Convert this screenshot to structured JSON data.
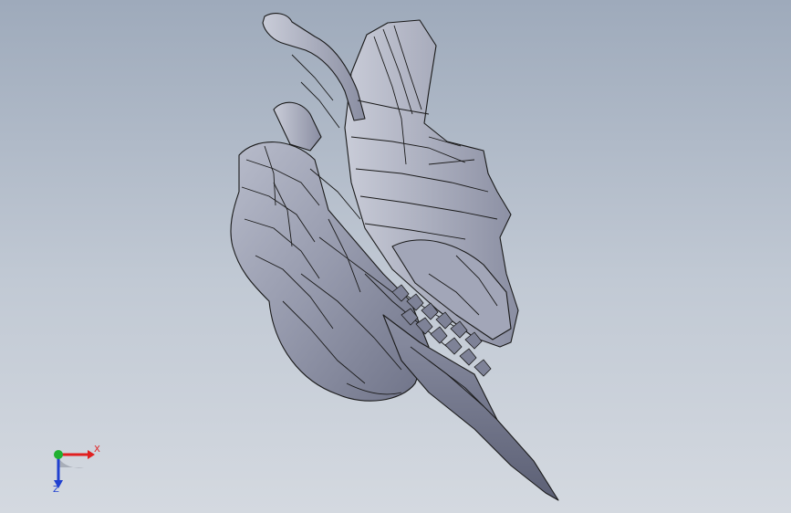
{
  "viewport": {
    "background_top": "#9eaabb",
    "background_bottom": "#d4d9e0"
  },
  "model": {
    "name": "sculpted-head-part",
    "shade_color": "#9396a9",
    "edge_color": "#1a1a1a"
  },
  "triad": {
    "x_label": "X",
    "z_label": "Z",
    "x_color": "#e02020",
    "y_color": "#20b030",
    "z_color": "#2040d0"
  }
}
